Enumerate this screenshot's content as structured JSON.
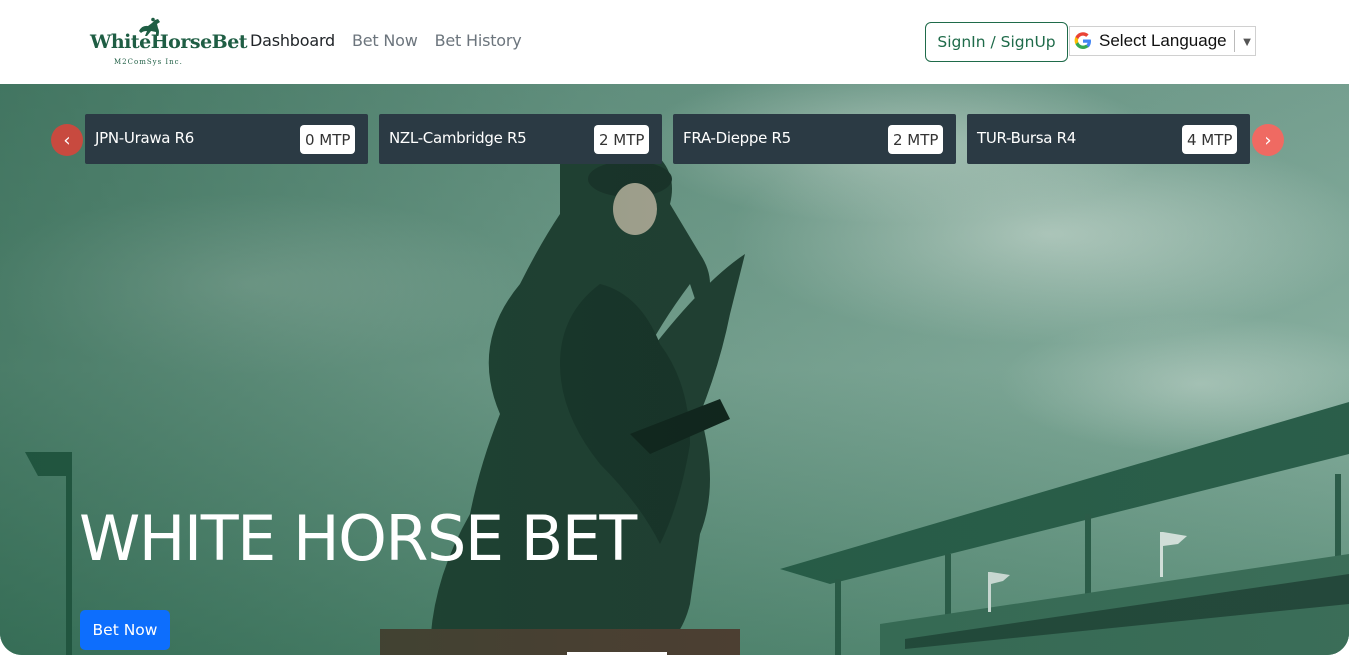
{
  "brand": {
    "name": "WhiteHorseBet",
    "tagline": "M2ComSys Inc."
  },
  "nav": {
    "items": [
      {
        "label": "Dashboard",
        "active": true
      },
      {
        "label": "Bet Now",
        "active": false
      },
      {
        "label": "Bet History",
        "active": false
      }
    ]
  },
  "header": {
    "signin_label": "SignIn / SignUp",
    "language_label": "Select Language",
    "language_caret": "▼"
  },
  "races": [
    {
      "name": "JPN-Urawa R6",
      "mtp": "0 MTP"
    },
    {
      "name": "NZL-Cambridge R5",
      "mtp": "2 MTP"
    },
    {
      "name": "FRA-Dieppe R5",
      "mtp": "2 MTP"
    },
    {
      "name": "TUR-Bursa R4",
      "mtp": "4 MTP"
    }
  ],
  "carousel": {
    "prev_icon": "‹",
    "next_icon": "›"
  },
  "hero": {
    "title": "WHITE HORSE BET",
    "cta_label": "Bet Now"
  },
  "colors": {
    "brand_green": "#1f6b4a",
    "card_bg": "#2b3a44",
    "cta_blue": "#0d6efd",
    "carousel_red": "#e05252"
  },
  "icons": {
    "logo": "horse-rider-icon",
    "language": "google-g-icon",
    "prev": "chevron-left-icon",
    "next": "chevron-right-icon"
  }
}
